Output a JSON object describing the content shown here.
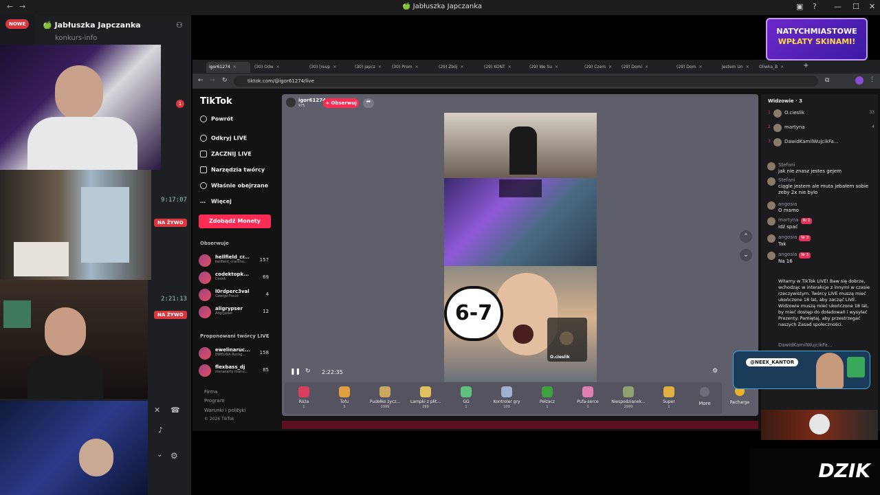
{
  "window": {
    "title": "🍏 Jabłuszka Japczanka"
  },
  "discord": {
    "new_badge": "NOWE",
    "server_name": "🍏 Jabłuszka Japczanka",
    "channel": "konkurs-info",
    "timers": [
      "9:17:07",
      "2:21:13"
    ],
    "live_label": "NA ŻYWO",
    "mention_count": "1"
  },
  "browser": {
    "tabs": [
      "igor61274",
      "(30) Odw",
      "(30) [reup",
      "(30) japcz",
      "(30) Prom",
      "(29) Zbój",
      "(29) KONT",
      "(29) We Su",
      "(29) Czem",
      "(29) Domi",
      "(29) Dom",
      "Jestem Un",
      "Oliwka_B"
    ],
    "url": "tiktok.com/@igor61274/live"
  },
  "tiktok": {
    "logo": "TikTok",
    "back": "Powrót",
    "nav": [
      "Odkryj LIVE",
      "ZACZNIJ LIVE",
      "Narzędzia twórcy",
      "Właśnie obejrzane",
      "Więcej"
    ],
    "coins_button": "Zdobądź Monety",
    "following_title": "Obserwuje",
    "following": [
      {
        "name": "hellfield_cr...",
        "sub": "hellfield_crackho...",
        "count": "157"
      },
      {
        "name": "codektopk...",
        "sub": "Codek",
        "count": "69"
      },
      {
        "name": "l0rdperc3val",
        "sub": "George Freud",
        "count": "4"
      },
      {
        "name": "aligrypser",
        "sub": "Aligrypser",
        "count": "12"
      }
    ],
    "suggested_title": "Proponowani twórcy LIVE",
    "suggested": [
      {
        "name": "ewelinaruc...",
        "sub": "EWELINA Ruckg...",
        "count": "158"
      },
      {
        "name": "flexbass_dj",
        "sub": "nienażarty mariu...",
        "count": "85"
      }
    ],
    "footer": [
      "Firma",
      "Program",
      "Warunki i polityki",
      "© 2026 TikTok"
    ]
  },
  "player": {
    "streamer": "igor61274",
    "streamer_sub": "975",
    "follow": "+ Obserwuj",
    "time": "2:22:35",
    "overlay_text": "6-7",
    "cam_label": "O.cieslik",
    "gifts": [
      {
        "name": "Róża",
        "price": "1"
      },
      {
        "name": "Tofu",
        "price": "5"
      },
      {
        "name": "Pudełko życz...",
        "price": "1999"
      },
      {
        "name": "Lampki z płit...",
        "price": "299"
      },
      {
        "name": "GG",
        "price": "1"
      },
      {
        "name": "Kontroler gry",
        "price": "100"
      },
      {
        "name": "Pełzacz",
        "price": "1"
      },
      {
        "name": "Pufa-serce",
        "price": "1"
      },
      {
        "name": "Niespodzianek...",
        "price": "2999"
      },
      {
        "name": "Super",
        "price": "1"
      }
    ],
    "more": "More",
    "recharge": "Recharge"
  },
  "chat": {
    "viewers_title": "Widzowie · 3",
    "viewers": [
      {
        "rank": "1",
        "name": "O.cieslik",
        "count": "33"
      },
      {
        "rank": "2",
        "name": "martyna",
        "count": "4"
      },
      {
        "rank": "3",
        "name": "DawidKamilWujcikFa...",
        "count": ""
      }
    ],
    "messages": [
      {
        "user": "Stefani",
        "badge": "",
        "text": "jak nie znasz jestes gejem"
      },
      {
        "user": "Stefani",
        "badge": "",
        "text": "ciągle jestem ale muta jebałem sobie zeby 2x nie bylo"
      },
      {
        "user": "angosia",
        "badge": "",
        "text": "O mamo"
      },
      {
        "user": "martyna",
        "badge": "Nr 2",
        "text": "idź spać"
      },
      {
        "user": "angosia",
        "badge": "Nr 3",
        "text": "Tak"
      },
      {
        "user": "angosia",
        "badge": "Nr 3",
        "text": "Na 16"
      }
    ],
    "system_msg": "Witamy w TikTok LIVE! Baw się dobrze, wchodząc w interakcje z innymi w czasie rzeczywistym. Twórcy LIVE muszą mieć ukończone 18 lat, aby zacząć LIVE. Widzowie muszą mieć ukończone 18 lat, by mieć dostęp do doładowań i wysyłać Prezenty. Pamiętaj, aby przestrzegać naszych Zasad społeczności.",
    "last_user": "DawidKamilWujcikFa..."
  },
  "overlays": {
    "promo_line1": "NATYCHMIASTOWE",
    "promo_line2": "WPŁATY SKINAMI!",
    "insta_tag": "@NEEX_KANTOR",
    "brand": "DZIK"
  },
  "colors": {
    "accent": "#fe2c55",
    "live": "#d9373f"
  }
}
